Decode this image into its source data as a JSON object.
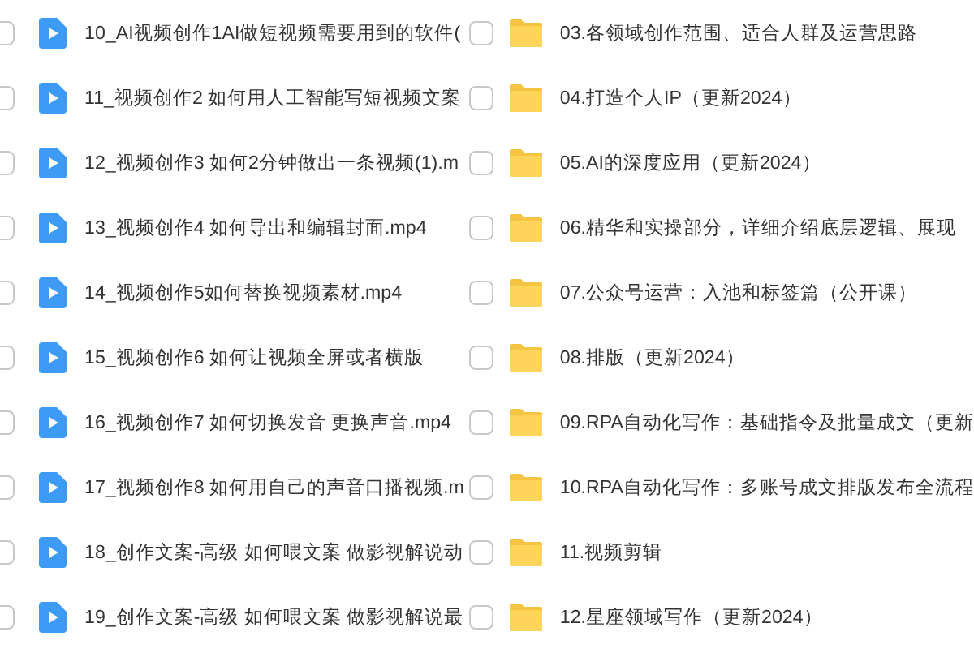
{
  "columns": [
    {
      "items": [
        {
          "kind": "video",
          "name": "10_AI视频创作1AI做短视频需要用到的软件(",
          "checked": false
        },
        {
          "kind": "video",
          "name": "11_视频创作2 如何用人工智能写短视频文案",
          "checked": false
        },
        {
          "kind": "video",
          "name": "12_视频创作3 如何2分钟做出一条视频(1).m",
          "checked": false
        },
        {
          "kind": "video",
          "name": "13_视频创作4 如何导出和编辑封面.mp4",
          "checked": false
        },
        {
          "kind": "video",
          "name": "14_视频创作5如何替换视频素材.mp4",
          "checked": false
        },
        {
          "kind": "video",
          "name": "15_视频创作6 如何让视频全屏或者横版",
          "checked": false
        },
        {
          "kind": "video",
          "name": "16_视频创作7 如何切换发音 更换声音.mp4",
          "checked": false
        },
        {
          "kind": "video",
          "name": "17_视频创作8 如何用自己的声音口播视频.m",
          "checked": false
        },
        {
          "kind": "video",
          "name": "18_创作文案-高级 如何喂文案 做影视解说动",
          "checked": false
        },
        {
          "kind": "video",
          "name": "19_创作文案-高级 如何喂文案 做影视解说最",
          "checked": false
        }
      ]
    },
    {
      "items": [
        {
          "kind": "folder",
          "name": "03.各领域创作范围、适合人群及运营思路",
          "checked": false
        },
        {
          "kind": "folder",
          "name": "04.打造个人IP（更新2024）",
          "checked": false
        },
        {
          "kind": "folder",
          "name": "05.AI的深度应用（更新2024）",
          "checked": false
        },
        {
          "kind": "folder",
          "name": "06.精华和实操部分，详细介绍底层逻辑、展现",
          "checked": false
        },
        {
          "kind": "folder",
          "name": "07.公众号运营：入池和标签篇（公开课）",
          "checked": false
        },
        {
          "kind": "folder",
          "name": "08.排版（更新2024）",
          "checked": false
        },
        {
          "kind": "folder",
          "name": "09.RPA自动化写作：基础指令及批量成文（更新",
          "checked": false
        },
        {
          "kind": "folder",
          "name": "10.RPA自动化写作：多账号成文排版发布全流程",
          "checked": false
        },
        {
          "kind": "folder",
          "name": "11.视频剪辑",
          "checked": false
        },
        {
          "kind": "folder",
          "name": "12.星座领域写作（更新2024）",
          "checked": false
        }
      ]
    }
  ]
}
